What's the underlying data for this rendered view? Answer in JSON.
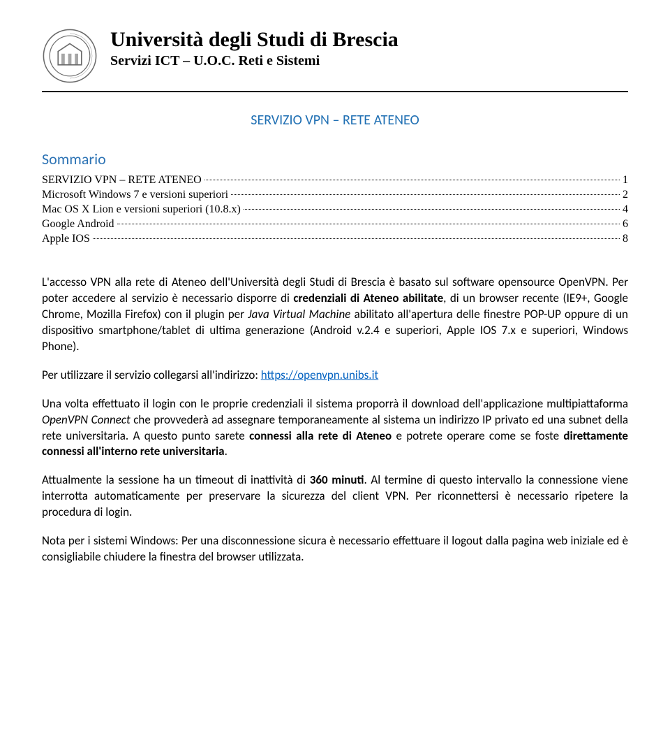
{
  "header": {
    "title": "Università degli Studi di Brescia",
    "subtitle": "Servizi ICT – U.O.C. Reti e Sistemi"
  },
  "doc_title": "SERVIZIO VPN – RETE ATENEO",
  "toc_head": "Sommario",
  "toc": [
    {
      "label": "SERVIZIO VPN – RETE ATENEO",
      "page": "1"
    },
    {
      "label": "Microsoft Windows 7 e versioni superiori",
      "page": "2"
    },
    {
      "label": "Mac OS X Lion e versioni superiori (10.8.x)",
      "page": "4"
    },
    {
      "label": "Google Android",
      "page": "6"
    },
    {
      "label": "Apple IOS",
      "page": "8"
    }
  ],
  "body": {
    "p1a": "L'accesso VPN alla rete di Ateneo dell'Università degli Studi di Brescia è basato sul software opensource OpenVPN. Per poter accedere al servizio è necessario disporre di ",
    "p1b": "credenziali di Ateneo abilitate",
    "p1c": ", di un browser recente (IE9+, Google Chrome, Mozilla Firefox) con il plugin per ",
    "p1d": "Java Virtual Machine",
    "p1e": " abilitato all'apertura delle finestre POP-UP oppure di un dispositivo smartphone/tablet di ultima generazione (Android v.2.4 e superiori, Apple IOS 7.x e superiori, Windows Phone).",
    "p2a": "Per utilizzare il servizio collegarsi all'indirizzo: ",
    "p2link": "https://openvpn.unibs.it",
    "p3a": "Una volta effettuato il login con le proprie credenziali il sistema proporrà il download dell'applicazione multipiattaforma ",
    "p3b": "OpenVPN Connect",
    "p3c": " che provvederà ad assegnare temporaneamente al sistema un indirizzo IP privato ed una subnet della rete universitaria. ",
    "p3d": "A questo punto sarete ",
    "p3e": "connessi alla rete di Ateneo",
    "p3f": " e potrete operare come se foste ",
    "p3g": "direttamente connessi all'interno rete universitaria",
    "p3h": ".",
    "p4a": "Attualmente la sessione ha un timeout di inattività  di ",
    "p4b": "360 minuti",
    "p4c": ". Al termine di questo intervallo la connessione viene interrotta automaticamente per preservare la sicurezza del client VPN. Per riconnettersi è necessario ripetere la procedura di login.",
    "p5": "Nota per i sistemi Windows: Per una disconnessione sicura è necessario effettuare il logout dalla pagina web iniziale ed è consigliabile chiudere la finestra del browser utilizzata."
  }
}
